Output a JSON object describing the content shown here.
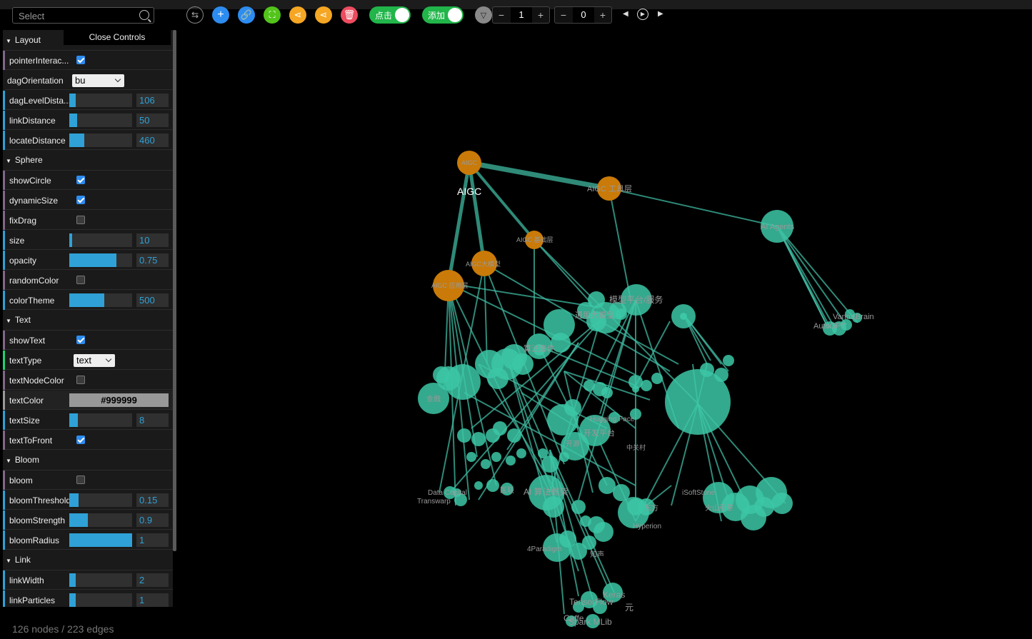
{
  "search": {
    "placeholder": "Select"
  },
  "toolbar": {
    "toggle_click_label": "点击",
    "toggle_add_label": "添加",
    "stepper1_value": "1",
    "stepper2_value": "0"
  },
  "panel": {
    "close_label": "Close Controls",
    "folders": {
      "layout": "Layout",
      "sphere": "Sphere",
      "text": "Text",
      "bloom": "Bloom",
      "link": "Link"
    },
    "layout": {
      "pointer_label": "pointerInterac...",
      "pointer_checked": true,
      "dag_orientation_label": "dagOrientation",
      "dag_orientation_value": "bu",
      "dag_level_label": "dagLevelDista...",
      "dag_level_value": "106",
      "dag_level_fill": 0.1,
      "link_distance_label": "linkDistance",
      "link_distance_value": "50",
      "link_distance_fill": 0.12,
      "locate_distance_label": "locateDistance",
      "locate_distance_value": "460",
      "locate_distance_fill": 0.24
    },
    "sphere": {
      "show_circle_label": "showCircle",
      "show_circle_checked": true,
      "dynamic_size_label": "dynamicSize",
      "dynamic_size_checked": true,
      "fix_drag_label": "fixDrag",
      "fix_drag_checked": false,
      "size_label": "size",
      "size_value": "10",
      "size_fill": 0.05,
      "opacity_label": "opacity",
      "opacity_value": "0.75",
      "opacity_fill": 0.75,
      "random_color_label": "randomColor",
      "random_color_checked": false,
      "color_theme_label": "colorTheme",
      "color_theme_value": "500",
      "color_theme_fill": 0.56
    },
    "text": {
      "show_text_label": "showText",
      "show_text_checked": true,
      "text_type_label": "textType",
      "text_type_value": "text",
      "text_node_color_label": "textNodeColor",
      "text_node_color_checked": false,
      "text_color_label": "textColor",
      "text_color_value": "#999999",
      "text_size_label": "textSize",
      "text_size_value": "8",
      "text_size_fill": 0.14,
      "text_to_front_label": "textToFront",
      "text_to_front_checked": true
    },
    "bloom": {
      "bloom_label": "bloom",
      "bloom_checked": false,
      "threshold_label": "bloomThreshold",
      "threshold_value": "0.15",
      "threshold_fill": 0.15,
      "strength_label": "bloomStrength",
      "strength_value": "0.9",
      "strength_fill": 0.3,
      "radius_label": "bloomRadius",
      "radius_value": "1",
      "radius_fill": 1.0
    },
    "link": {
      "link_width_label": "linkWidth",
      "link_width_value": "2",
      "link_width_fill": 0.1,
      "link_particles_label": "linkParticles",
      "link_particles_value": "1",
      "link_particles_fill": 0.1
    }
  },
  "colors": {
    "node_teal": "#3cc7a6",
    "node_orange": "#c97a08",
    "link": "#3fb8a0",
    "slider_fill": "#2fa1d6"
  },
  "graph": {
    "labels": {
      "aigc_big": "AIGC",
      "aigc_small": "AIGC",
      "tool_layer": "AIGC 工具层",
      "ai_agents": "AI Agents",
      "base_layer": "AIGC 基础层",
      "big_model": "AIGC大模型",
      "app_layer": "AIGC 应用层",
      "platform": "模型平台/服务",
      "general_model": "通用大模型",
      "algo_engine": "算法套件",
      "finance": "金融",
      "huggingface": "Hugging Face",
      "dev_platform": "开发平台",
      "open_source": "开源",
      "zgc": "中关村",
      "ai_algo": "AI 算法框架",
      "data_capital": "Data Capital",
      "transwarp": "Transwarp",
      "med": "医联",
      "isoftstone": "iSoftStone",
      "huoshan": "火山引擎",
      "dongfang": "东方",
      "hyperion": "Hyperion",
      "fourparadigm": "4Paradigm",
      "zhisheng": "知声",
      "keras": "Keras",
      "tensorflow": "TensorFlow",
      "caffe": "Caffe",
      "sparkmlib": "Spark MLib",
      "xuanyuan": "元",
      "vanna": "Vanna",
      "brain": "Brain",
      "autogpt": "AutoGPT"
    }
  },
  "status": {
    "summary": "126 nodes / 223 edges"
  }
}
